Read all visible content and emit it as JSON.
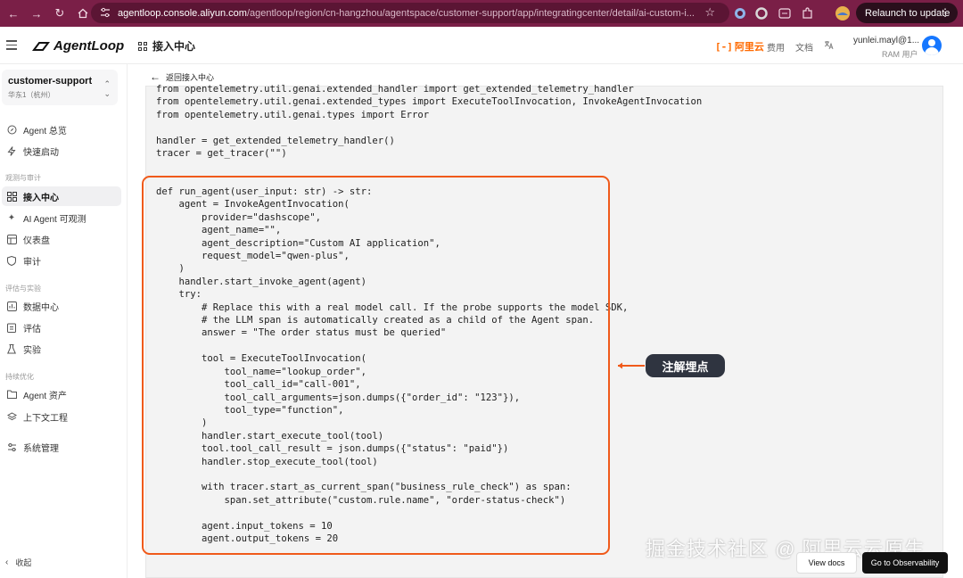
{
  "browser": {
    "url_host": "agentloop.console.aliyun.com",
    "url_path": "/agentloop/region/cn-hangzhou/agentspace/customer-support/app/integratingcenter/detail/ai-custom-i...",
    "relaunch_label": "Relaunch to update"
  },
  "header": {
    "logo_text": "AgentLoop",
    "page_title": "接入中心",
    "aliyun_label": "阿里云",
    "links": [
      "费用",
      "文档"
    ],
    "user_name": "yunlei.mayl@1...",
    "user_role": "RAM 用户"
  },
  "sidebar": {
    "workspace_name": "customer-support",
    "workspace_region": "华东1（杭州）",
    "items": [
      {
        "label": "Agent 总览",
        "icon": "compass-icon"
      },
      {
        "label": "快速启动",
        "icon": "lightning-icon"
      },
      {
        "group": "观测与审计"
      },
      {
        "label": "接入中心",
        "icon": "grid-icon",
        "active": true
      },
      {
        "label": "AI Agent 可观测",
        "icon": "sparkle-icon"
      },
      {
        "label": "仪表盘",
        "icon": "dashboard-icon"
      },
      {
        "label": "审计",
        "icon": "shield-icon"
      },
      {
        "group": "评估与实验"
      },
      {
        "label": "数据中心",
        "icon": "database-icon"
      },
      {
        "label": "评估",
        "icon": "clipboard-icon"
      },
      {
        "label": "实验",
        "icon": "flask-icon"
      },
      {
        "group": "持续优化"
      },
      {
        "label": "Agent 资产",
        "icon": "folder-icon"
      },
      {
        "label": "上下文工程",
        "icon": "layers-icon"
      },
      {
        "label": "系统管理",
        "icon": "settings-icon"
      }
    ],
    "collapse_label": "收起"
  },
  "content": {
    "back_label": "返回接入中心",
    "code_top": [
      "from opentelemetry.util.genai.extended_handler import get_extended_telemetry_handler",
      "from opentelemetry.util.genai.extended_types import ExecuteToolInvocation, InvokeAgentInvocation",
      "from opentelemetry.util.genai.types import Error",
      "",
      "handler = get_extended_telemetry_handler()",
      "tracer = get_tracer(\"\")"
    ],
    "code_main": [
      "def run_agent(user_input: str) -> str:",
      "    agent = InvokeAgentInvocation(",
      "        provider=\"dashscope\",",
      "        agent_name=\"\",",
      "        agent_description=\"Custom AI application\",",
      "        request_model=\"qwen-plus\",",
      "    )",
      "    handler.start_invoke_agent(agent)",
      "    try:",
      "        # Replace this with a real model call. If the probe supports the model SDK,",
      "        # the LLM span is automatically created as a child of the Agent span.",
      "        answer = \"The order status must be queried\"",
      "",
      "        tool = ExecuteToolInvocation(",
      "            tool_name=\"lookup_order\",",
      "            tool_call_id=\"call-001\",",
      "            tool_call_arguments=json.dumps({\"order_id\": \"123\"}),",
      "            tool_type=\"function\",",
      "        )",
      "        handler.start_execute_tool(tool)",
      "        tool.tool_call_result = json.dumps({\"status\": \"paid\"})",
      "        handler.stop_execute_tool(tool)",
      "",
      "        with tracer.start_as_current_span(\"business_rule_check\") as span:",
      "            span.set_attribute(\"custom.rule.name\", \"order-status-check\")",
      "",
      "        agent.input_tokens = 10",
      "        agent.output_tokens = 20"
    ],
    "annotation_label": "注解埋点",
    "watermark": "掘金技术社区 @ 阿里云云原生",
    "view_docs_label": "View docs",
    "go_obs_label": "Go to Observability"
  },
  "colors": {
    "chrome": "#7a1f47",
    "highlight": "#f05a1a",
    "brand": "#ff6a00",
    "annotation_bg": "#2f3440"
  }
}
